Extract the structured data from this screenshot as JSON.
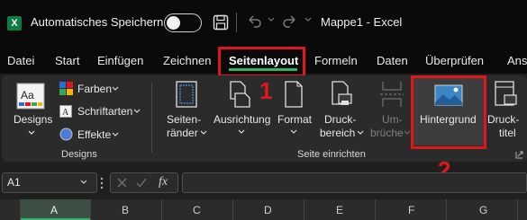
{
  "titlebar": {
    "app_logo": "X",
    "autosave_label": "Automatisches Speichern",
    "doc_title": "Mappe1  -  Excel",
    "icons": [
      "excel-logo-icon",
      "save-icon",
      "undo-icon",
      "redo-icon",
      "chevron-down-icon"
    ]
  },
  "tabs": [
    {
      "label": "Datei"
    },
    {
      "label": "Start"
    },
    {
      "label": "Einfügen"
    },
    {
      "label": "Zeichnen"
    },
    {
      "label": "Seitenlayout"
    },
    {
      "label": "Formeln"
    },
    {
      "label": "Daten"
    },
    {
      "label": "Überprüfen"
    },
    {
      "label": "Ansi"
    }
  ],
  "ribbon": {
    "designs": {
      "designs_label": "Designs",
      "farben_label": "Farben",
      "schriftarten_label": "Schriftarten",
      "effekte_label": "Effekte",
      "group_label": "Designs"
    },
    "seite": {
      "seitenraender_line1": "Seiten-",
      "seitenraender_line2": "ränder",
      "ausrichtung_label": "Ausrichtung",
      "format_label": "Format",
      "druckbereich_line1": "Druck-",
      "druckbereich_line2": "bereich",
      "umbrueche_line1": "Um-",
      "umbrueche_line2": "brüche",
      "hintergrund_label": "Hintergrund",
      "drucktitel_line1": "Druck-",
      "drucktitel_line2": "titel",
      "group_label": "Seite einrichten"
    }
  },
  "annotations": {
    "step1": "1",
    "step2": "2"
  },
  "formula_bar": {
    "namebox_value": "A1",
    "fx_label": "fx"
  },
  "columns": [
    "A",
    "B",
    "C",
    "D",
    "E",
    "F",
    "G"
  ],
  "colors": {
    "accent_green": "#2fb36a",
    "annotation_red": "#e0161d",
    "excel_green": "#107c41"
  }
}
